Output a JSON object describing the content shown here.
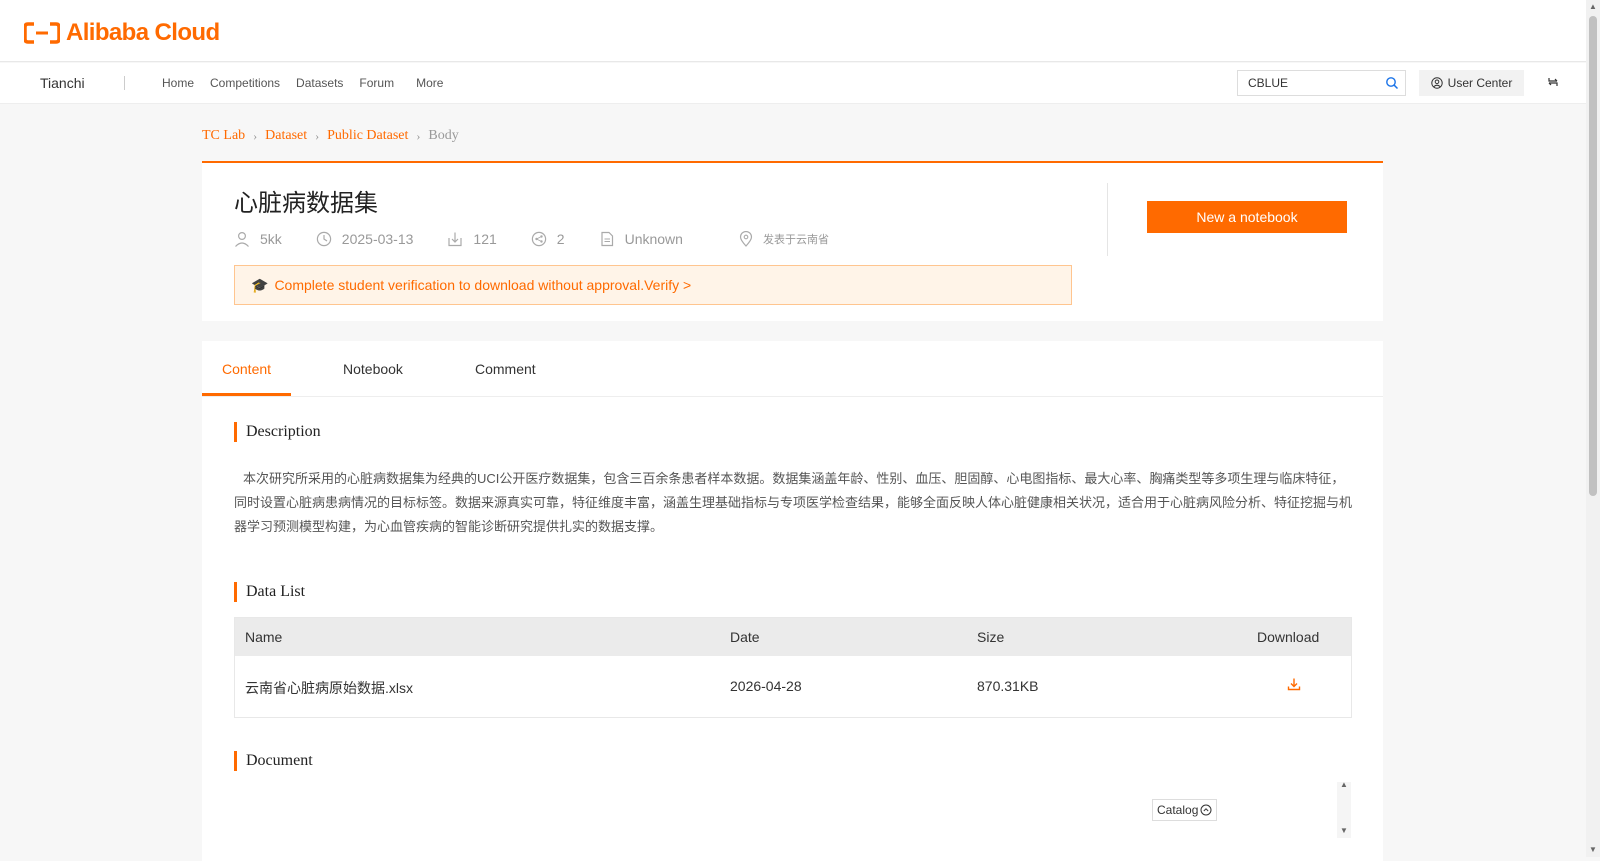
{
  "header": {
    "logo_text": "Alibaba Cloud"
  },
  "nav": {
    "brand": "Tianchi",
    "links": [
      "Home",
      "Competitions",
      "Datasets",
      "Forum",
      "More"
    ],
    "search_value": "CBLUE",
    "user_center": "User Center"
  },
  "breadcrumb": [
    "TC Lab",
    "Dataset",
    "Public Dataset",
    "Body"
  ],
  "dataset": {
    "title": "心脏病数据集",
    "author": "5kk",
    "date": "2025-03-13",
    "downloads": "121",
    "shares": "2",
    "license": "Unknown",
    "location": "发表于云南省",
    "banner_text": "Complete student verification to download without approval.",
    "banner_link": "Verify >",
    "new_notebook": "New a notebook"
  },
  "tabs": [
    "Content",
    "Notebook",
    "Comment"
  ],
  "content": {
    "description_title": "Description",
    "description_text": "本次研究所采用的心脏病数据集为经典的UCI公开医疗数据集，包含三百余条患者样本数据。数据集涵盖年龄、性别、血压、胆固醇、心电图指标、最大心率、胸痛类型等多项生理与临床特征，同时设置心脏病患病情况的目标标签。数据来源真实可靠，特征维度丰富，涵盖生理基础指标与专项医学检查结果，能够全面反映人体心脏健康相关状况，适合用于心脏病风险分析、特征挖掘与机器学习预测模型构建，为心血管疾病的智能诊断研究提供扎实的数据支撑。",
    "datalist_title": "Data List",
    "table_headers": [
      "Name",
      "Date",
      "Size",
      "Download"
    ],
    "rows": [
      {
        "name": "云南省心脏病原始数据.xlsx",
        "date": "2026-04-28",
        "size": "870.31KB"
      }
    ],
    "document_title": "Document",
    "catalog": "Catalog"
  },
  "colors": {
    "accent": "#ff6a00",
    "banner_bg": "#fff4e8",
    "page_bg": "#f7f7f7"
  },
  "icons": [
    "alibaba-logo-icon",
    "search-icon",
    "user-icon",
    "switch-icon",
    "author-icon",
    "clock-icon",
    "download-count-icon",
    "share-icon",
    "file-icon",
    "location-icon",
    "graduation-cap-icon",
    "download-icon",
    "catalog-icon"
  ]
}
